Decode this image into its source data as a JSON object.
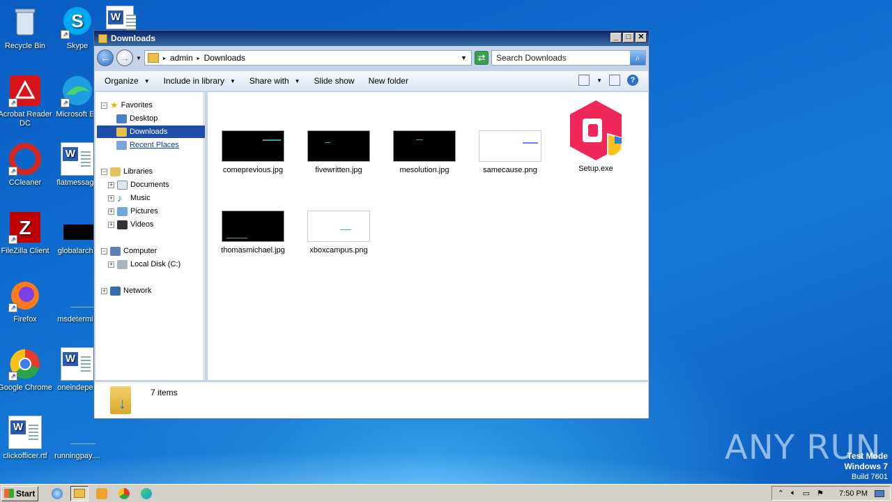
{
  "desktop": {
    "icons": [
      {
        "label": "Recycle Bin",
        "icon": "recycle-bin-icon"
      },
      {
        "label": "Skype",
        "icon": "skype-icon"
      },
      {
        "label": "Acrobat Reader DC",
        "icon": "acrobat-icon"
      },
      {
        "label": "Microsoft Ed",
        "icon": "edge-icon"
      },
      {
        "label": "CCleaner",
        "icon": "ccleaner-icon"
      },
      {
        "label": "flatmessage",
        "icon": "word-doc-icon"
      },
      {
        "label": "FileZilla Client",
        "icon": "filezilla-icon"
      },
      {
        "label": "globalarchit",
        "icon": "image-file-icon"
      },
      {
        "label": "Firefox",
        "icon": "firefox-icon"
      },
      {
        "label": "msdetermin",
        "icon": "blank-file-icon"
      },
      {
        "label": "Google Chrome",
        "icon": "chrome-icon"
      },
      {
        "label": "oneindepen",
        "icon": "word-doc-icon"
      },
      {
        "label": "clickofficer.rtf",
        "icon": "word-doc-icon"
      },
      {
        "label": "runningpay....",
        "icon": "blank-file-icon"
      }
    ]
  },
  "window": {
    "title": "Downloads",
    "controls": {
      "minimize": "_",
      "maximize": "□",
      "close": "✕"
    },
    "breadcrumb": [
      "admin",
      "Downloads"
    ],
    "search_placeholder": "Search Downloads",
    "toolbar": {
      "organize": "Organize",
      "include_in_library": "Include in library",
      "share_with": "Share with",
      "slide_show": "Slide show",
      "new_folder": "New folder"
    },
    "nav": {
      "favorites": "Favorites",
      "desktop": "Desktop",
      "downloads": "Downloads",
      "recent_places": "Recent Places",
      "libraries": "Libraries",
      "documents": "Documents",
      "music": "Music",
      "pictures": "Pictures",
      "videos": "Videos",
      "computer": "Computer",
      "local_disk": "Local Disk (C:)",
      "network": "Network"
    },
    "files": [
      {
        "name": "comeprevious.jpg"
      },
      {
        "name": "fivewritten.jpg"
      },
      {
        "name": "mesolution.jpg"
      },
      {
        "name": "samecause.png"
      },
      {
        "name": "Setup.exe"
      },
      {
        "name": "thomasmichael.jpg"
      },
      {
        "name": "xboxcampus.png"
      }
    ],
    "status": "7 items"
  },
  "taskbar": {
    "start": "Start",
    "apps": [
      "internet-explorer-icon",
      "explorer-icon",
      "media-player-icon",
      "chrome-icon",
      "edge-icon"
    ],
    "clock": "7:50 PM"
  },
  "watermark": {
    "line1": "Test Mode",
    "line2": "Windows 7",
    "line3": "Build 7601",
    "brand": "ANY RUN"
  },
  "colors": {
    "selection": "#1f4ea8",
    "titlebar": "#0a246a"
  }
}
